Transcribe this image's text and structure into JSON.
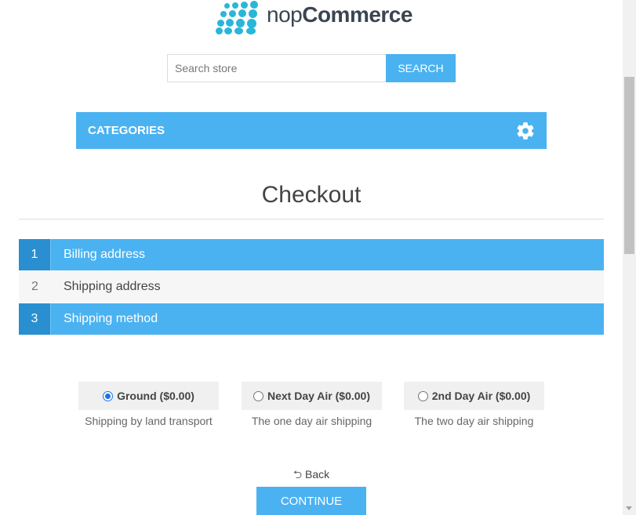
{
  "brand": {
    "name_light": "nop",
    "name_bold": "Commerce",
    "color": "#2ab6d8"
  },
  "search": {
    "placeholder": "Search store",
    "button_label": "SEARCH"
  },
  "categories": {
    "label": "CATEGORIES",
    "icon": "gear-icon"
  },
  "page": {
    "title": "Checkout"
  },
  "steps": [
    {
      "number": "1",
      "label": "Billing address",
      "state": "active"
    },
    {
      "number": "2",
      "label": "Shipping address",
      "state": "inactive"
    },
    {
      "number": "3",
      "label": "Shipping method",
      "state": "active"
    }
  ],
  "shipping_options": [
    {
      "label": "Ground ($0.00)",
      "description": "Shipping by land transport",
      "selected": true
    },
    {
      "label": "Next Day Air ($0.00)",
      "description": "The one day air shipping",
      "selected": false
    },
    {
      "label": "2nd Day Air ($0.00)",
      "description": "The two day air shipping",
      "selected": false
    }
  ],
  "actions": {
    "back_label": "Back",
    "back_icon": "undo-arrow-icon",
    "continue_label": "CONTINUE"
  },
  "colors": {
    "accent": "#4ab2f1",
    "accent_dark": "#2a8fd0",
    "inactive_bg": "#f6f6f6"
  }
}
